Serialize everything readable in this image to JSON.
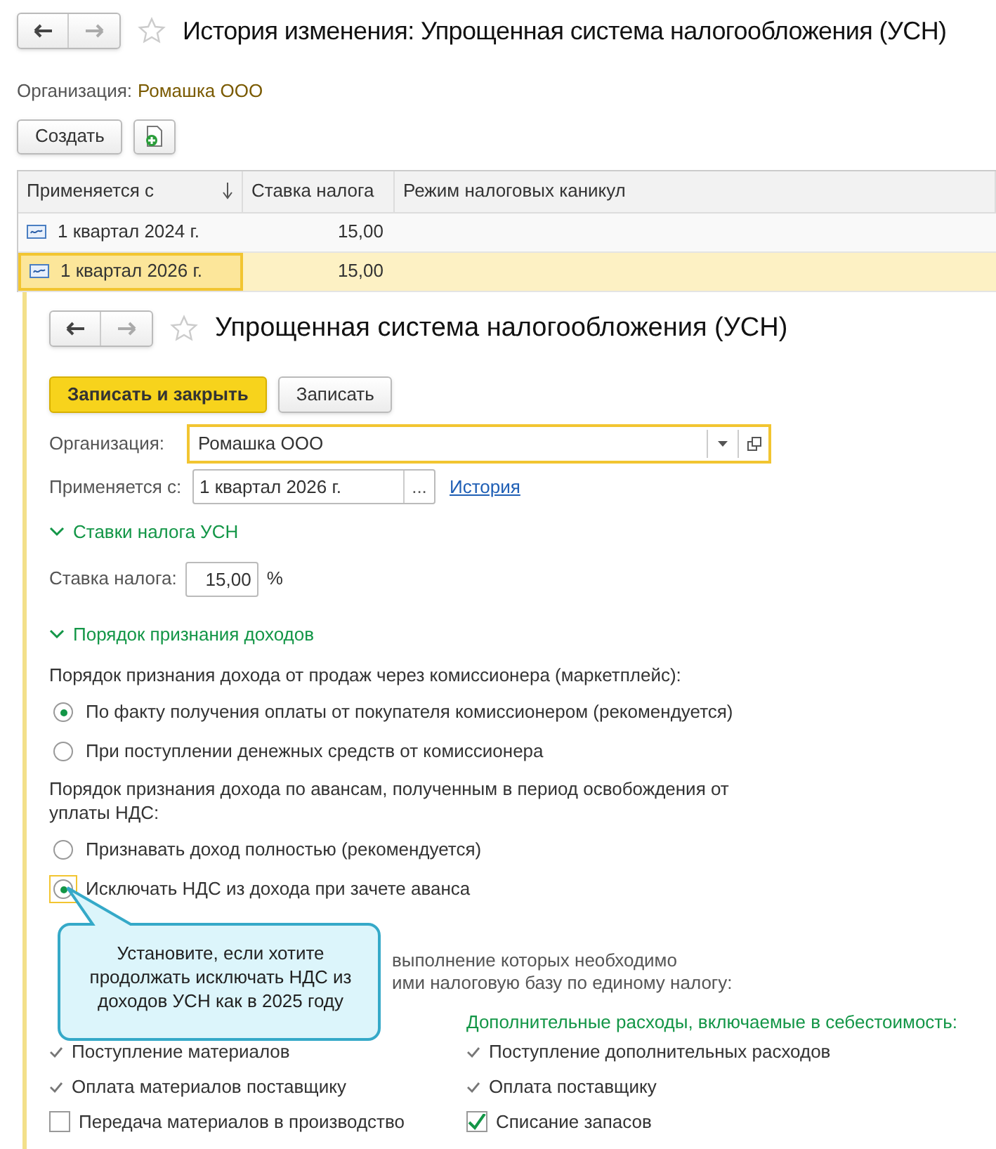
{
  "window": {
    "title": "История изменения: Упрощенная система налогообложения (УСН)"
  },
  "organization": {
    "label": "Организация:",
    "value": "Ромашка ООО"
  },
  "toolbar": {
    "create_button": "Создать"
  },
  "table": {
    "columns": [
      {
        "label": "Применяется с",
        "sorted": true
      },
      {
        "label": "Ставка налога",
        "sorted": false
      },
      {
        "label": "Режим налоговых каникул",
        "sorted": false
      }
    ],
    "rows": [
      {
        "applies_from": "1 квартал 2024 г.",
        "tax_rate": "15,00",
        "selected": false
      },
      {
        "applies_from": "1 квартал 2026 г.",
        "tax_rate": "15,00",
        "selected": true
      }
    ]
  },
  "form": {
    "title": "Упрощенная система налогообложения (УСН)",
    "buttons": [
      {
        "label": "Записать и закрыть",
        "primary": true
      },
      {
        "label": "Записать",
        "primary": false
      }
    ],
    "organization": {
      "label": "Организация:",
      "value": "Ромашка ООО"
    },
    "applies_from": {
      "label": "Применяется с:",
      "value": "1 квартал 2026 г.",
      "choose_button": "...",
      "link": "История"
    },
    "rates_section": {
      "title": "Ставки налога УСН",
      "expanded": true,
      "rate_label": "Ставка налога:",
      "rate_value": "15,00",
      "unit": "%"
    },
    "income_section": {
      "title": "Порядок признания доходов",
      "expanded": true,
      "groups": [
        {
          "question": "Порядок признания дохода от продаж через комиссионера (маркетплейс):",
          "options": [
            {
              "label": "По факту получения оплаты от покупателя комиссионером (рекомендуется)",
              "selected": true,
              "focused": false
            },
            {
              "label": "При поступлении денежных средств от комиссионера",
              "selected": false,
              "focused": false
            }
          ]
        },
        {
          "question": "Порядок признания дохода по авансам, полученным в период освобождения от уплаты НДС:",
          "options": [
            {
              "label": "Признавать доход полностью (рекомендуется)",
              "selected": false,
              "focused": false
            },
            {
              "label": "Исключать НДС из дохода при зачете аванса",
              "selected": true,
              "focused": true
            }
          ]
        }
      ]
    },
    "expenses": {
      "note_line_1": "выполнение которых необходимо",
      "note_line_2": "ими налоговую базу по единому налогу:",
      "left_items": [
        {
          "kind": "mark",
          "label": "Поступление материалов"
        },
        {
          "kind": "mark",
          "label": "Оплата материалов поставщику"
        },
        {
          "kind": "checkbox",
          "label": "Передача материалов в производство",
          "checked": false
        }
      ],
      "right_title": "Дополнительные расходы, включаемые в себестоимость:",
      "right_items": [
        {
          "kind": "mark",
          "label": "Поступление дополнительных расходов"
        },
        {
          "kind": "mark",
          "label": "Оплата поставщику"
        },
        {
          "kind": "checkbox",
          "label": "Списание запасов",
          "checked": true
        }
      ]
    }
  },
  "callout": {
    "text": "Установите, если хотите продолжать исключать НДС из доходов УСН как в 2025 году"
  }
}
